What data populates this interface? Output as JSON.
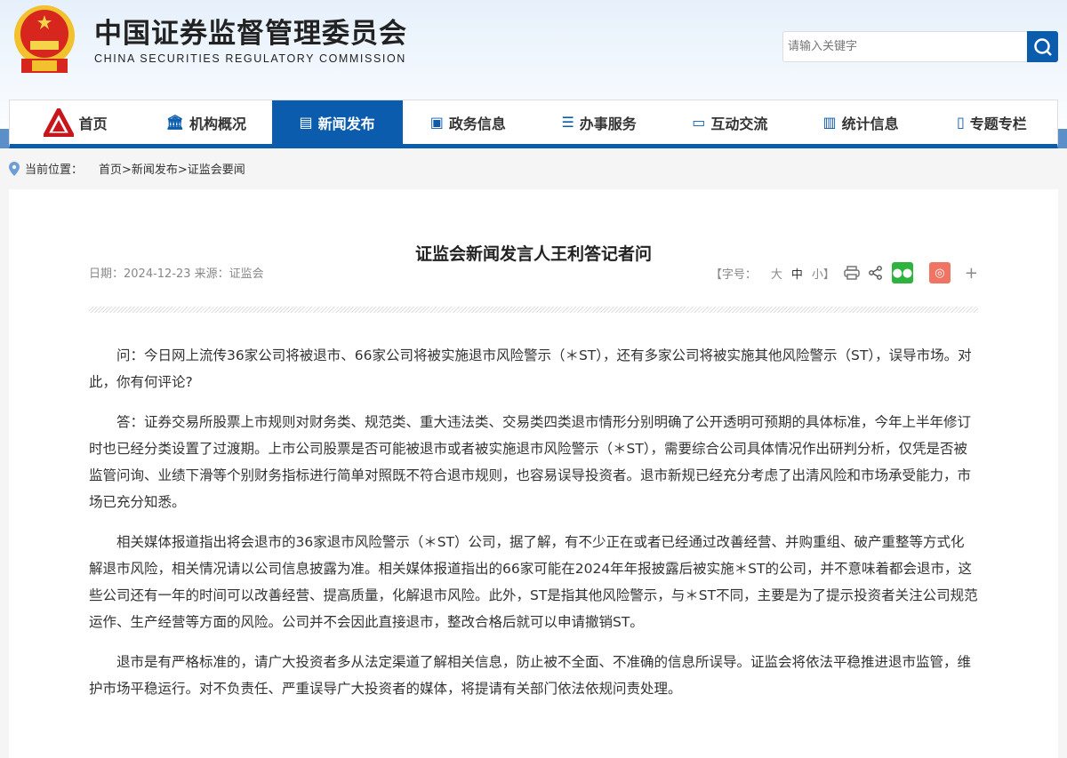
{
  "header": {
    "title_cn": "中国证券监督管理委员会",
    "title_en": "CHINA SECURITIES REGULATORY COMMISSION",
    "search_placeholder": "请输入关键字"
  },
  "nav": [
    {
      "label": "首页",
      "icon": "home-logo-icon"
    },
    {
      "label": "机构概况",
      "icon": "building-icon"
    },
    {
      "label": "新闻发布",
      "icon": "news-icon",
      "active": true
    },
    {
      "label": "政务信息",
      "icon": "monitor-icon"
    },
    {
      "label": "办事服务",
      "icon": "list-icon"
    },
    {
      "label": "互动交流",
      "icon": "chat-icon"
    },
    {
      "label": "统计信息",
      "icon": "bar-chart-icon"
    },
    {
      "label": "专题专栏",
      "icon": "document-icon"
    }
  ],
  "breadcrumb": {
    "label": "当前位置：",
    "path": "首页>新闻发布>证监会要闻"
  },
  "article": {
    "title": "证监会新闻发言人王利答记者问",
    "meta": "日期：2024-12-23 来源：证监会",
    "font_label": "【字号：",
    "font_large": "大",
    "font_medium": "中",
    "font_small": "小】",
    "plus": "+",
    "paragraphs": [
      "问：今日网上流传36家公司将被退市、66家公司将被实施退市风险警示（＊ST），还有多家公司将被实施其他风险警示（ST），误导市场。对此，你有何评论?",
      "答：证券交易所股票上市规则对财务类、规范类、重大违法类、交易类四类退市情形分别明确了公开透明可预期的具体标准，今年上半年修订时也已经分类设置了过渡期。上市公司股票是否可能被退市或者被实施退市风险警示（＊ST），需要综合公司具体情况作出研判分析，仅凭是否被监管问询、业绩下滑等个别财务指标进行简单对照既不符合退市规则，也容易误导投资者。退市新规已经充分考虑了出清风险和市场承受能力，市场已充分知悉。",
      "相关媒体报道指出将会退市的36家退市风险警示（＊ST）公司，据了解，有不少正在或者已经通过改善经营、并购重组、破产重整等方式化解退市风险，相关情况请以公司信息披露为准。相关媒体报道指出的66家可能在2024年年报披露后被实施＊ST的公司，并不意味着都会退市，这些公司还有一年的时间可以改善经营、提高质量，化解退市风险。此外，ST是指其他风险警示，与＊ST不同，主要是为了提示投资者关注公司规范运作、生产经营等方面的风险。公司并不会因此直接退市，整改合格后就可以申请撤销ST。",
      "退市是有严格标准的，请广大投资者多从法定渠道了解相关信息，防止被不全面、不准确的信息所误导。证监会将依法平稳推进退市监管，维护市场平稳运行。对不负责任、严重误导广大投资者的媒体，将提请有关部门依法依规问责处理。"
    ]
  },
  "colors": {
    "brand": "#0b5cad",
    "wechat": "#2fb33e",
    "weibo": "#f07464"
  }
}
